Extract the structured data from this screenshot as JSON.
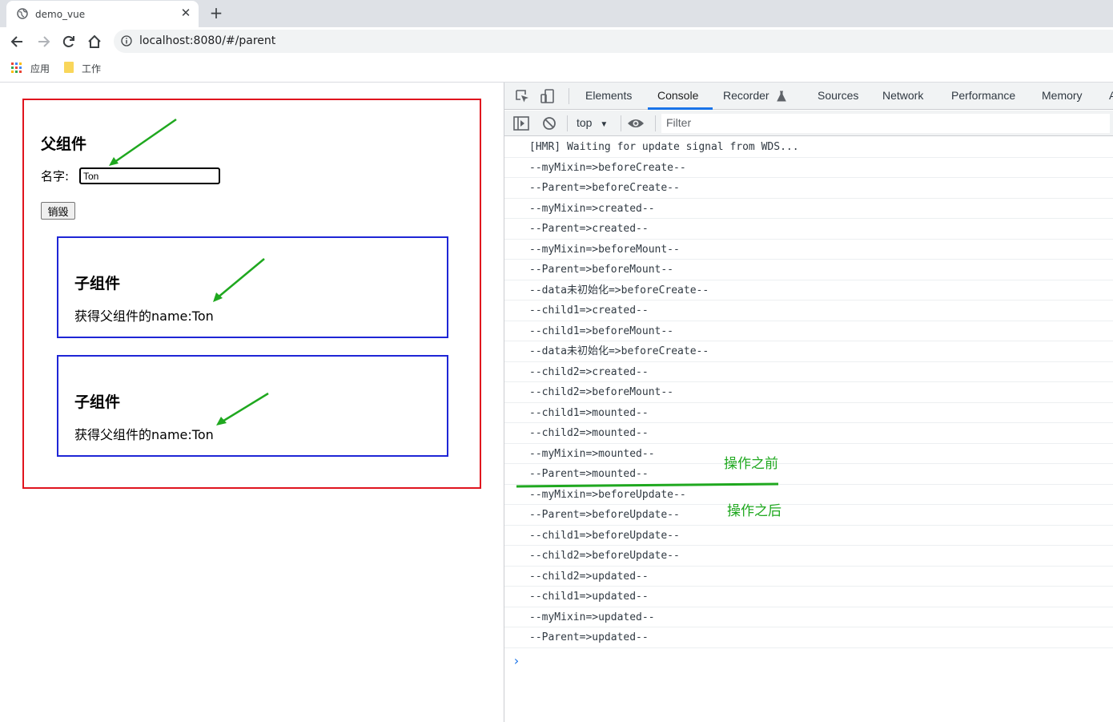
{
  "browser": {
    "tab_title": "demo_vue",
    "url": "localhost:8080/#/parent",
    "bookmarks": [
      {
        "label": "应用"
      },
      {
        "label": "工作"
      }
    ]
  },
  "page": {
    "parent_title": "父组件",
    "name_label": "名字:",
    "name_value": "Ton",
    "destroy_button": "销毁",
    "children": [
      {
        "title": "子组件",
        "text": "获得父组件的name:Ton"
      },
      {
        "title": "子组件",
        "text": "获得父组件的name:Ton"
      }
    ]
  },
  "devtools": {
    "tabs": [
      "Elements",
      "Console",
      "Recorder",
      "Sources",
      "Network",
      "Performance",
      "Memory",
      "A"
    ],
    "active_tab": "Console",
    "context": "top",
    "filter_placeholder": "Filter",
    "logs": [
      "[HMR] Waiting for update signal from WDS...",
      "--myMixin=>beforeCreate--",
      "--Parent=>beforeCreate--",
      "--myMixin=>created--",
      "--Parent=>created--",
      "--myMixin=>beforeMount--",
      "--Parent=>beforeMount--",
      "--data未初始化=>beforeCreate--",
      "--child1=>created--",
      "--child1=>beforeMount--",
      "--data未初始化=>beforeCreate--",
      "--child2=>created--",
      "--child2=>beforeMount--",
      "--child1=>mounted--",
      "--child2=>mounted--",
      "--myMixin=>mounted--",
      "--Parent=>mounted--",
      "--myMixin=>beforeUpdate--",
      "--Parent=>beforeUpdate--",
      "--child1=>beforeUpdate--",
      "--child2=>beforeUpdate--",
      "--child2=>updated--",
      "--child1=>updated--",
      "--myMixin=>updated--",
      "--Parent=>updated--"
    ]
  },
  "annotations": {
    "before": "操作之前",
    "after": "操作之后"
  },
  "colors": {
    "parent_border": "#e0141e",
    "child_border": "#1f26d6",
    "annotation": "#1fa81f",
    "devtools_active": "#1a73e8"
  }
}
